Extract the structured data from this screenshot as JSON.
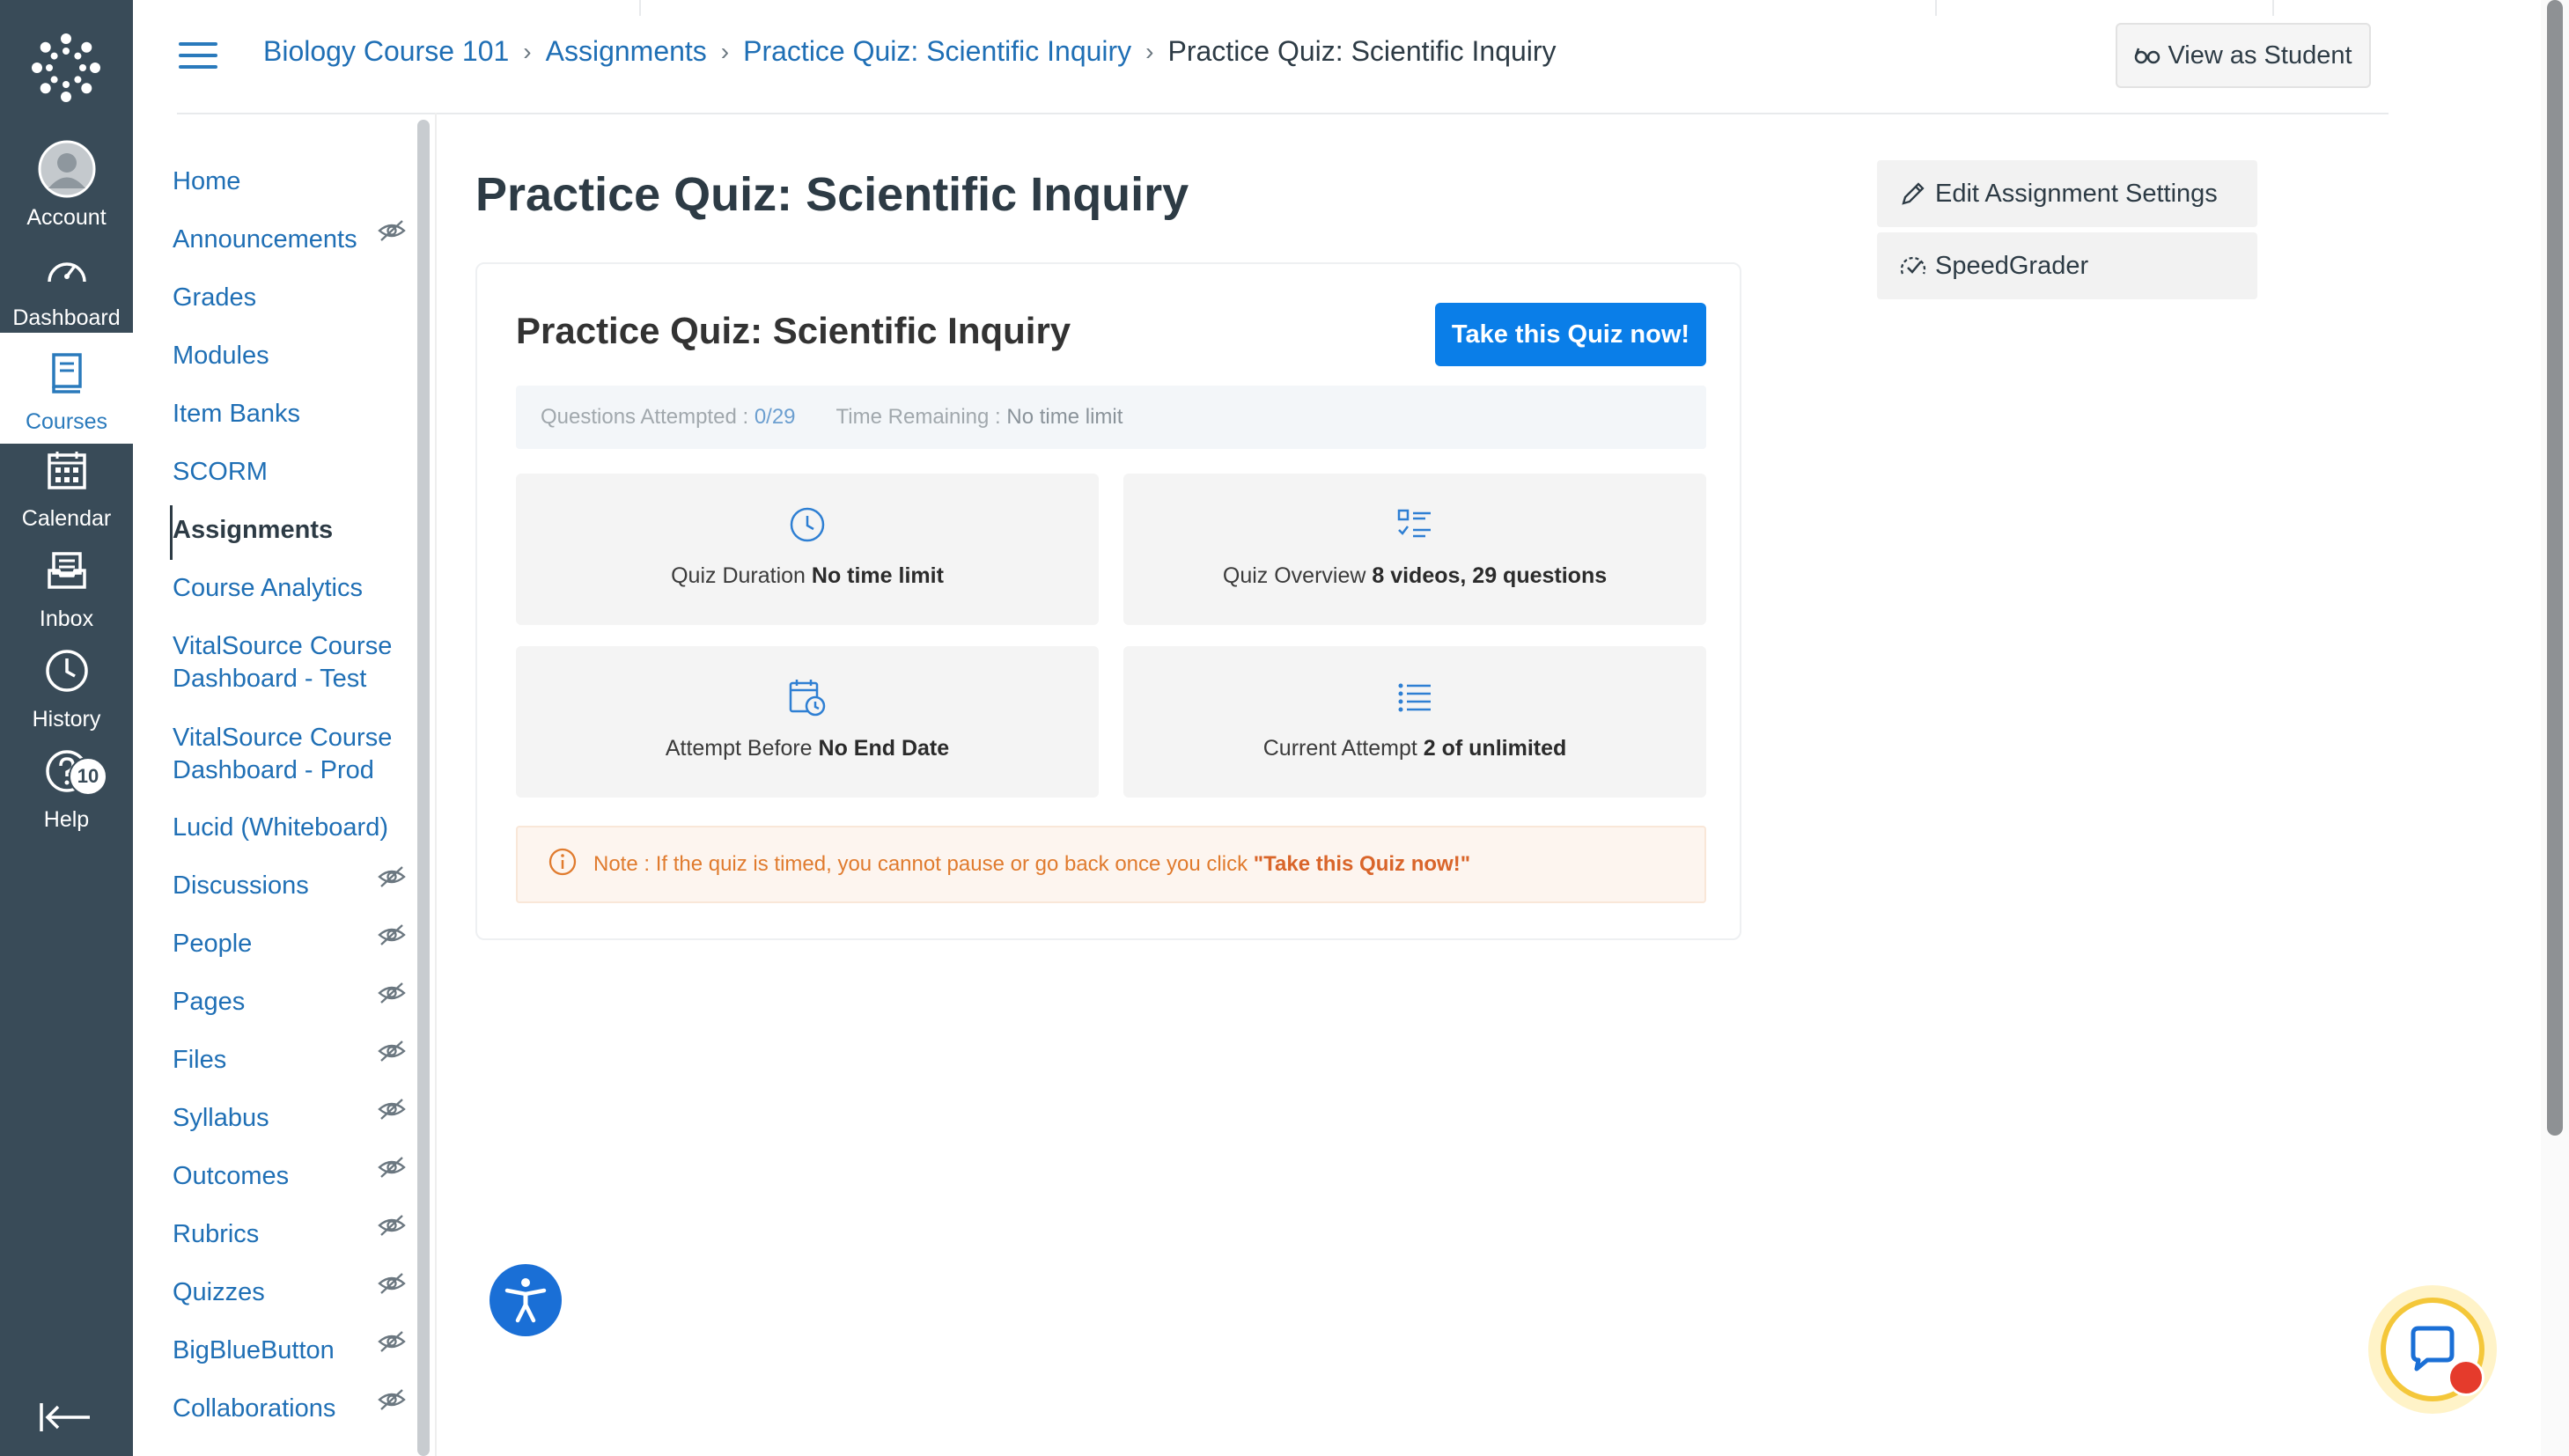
{
  "global_nav": {
    "items": [
      {
        "label": "Account",
        "icon": "account-avatar-icon"
      },
      {
        "label": "Dashboard",
        "icon": "dashboard-gauge-icon"
      },
      {
        "label": "Courses",
        "icon": "courses-book-icon",
        "active": true
      },
      {
        "label": "Calendar",
        "icon": "calendar-icon"
      },
      {
        "label": "Inbox",
        "icon": "inbox-icon"
      },
      {
        "label": "History",
        "icon": "clock-icon"
      },
      {
        "label": "Help",
        "icon": "help-question-icon",
        "badge": "10"
      }
    ]
  },
  "header": {
    "breadcrumbs": [
      {
        "label": "Biology Course 101"
      },
      {
        "label": "Assignments"
      },
      {
        "label": "Practice Quiz: Scientific Inquiry"
      },
      {
        "label": "Practice Quiz: Scientific Inquiry"
      }
    ],
    "view_as_student": "View as Student"
  },
  "course_nav": {
    "items": [
      {
        "label": "Home"
      },
      {
        "label": "Announcements",
        "hidden": true
      },
      {
        "label": "Grades"
      },
      {
        "label": "Modules"
      },
      {
        "label": "Item Banks"
      },
      {
        "label": "SCORM"
      },
      {
        "label": "Assignments",
        "active": true
      },
      {
        "label": "Course Analytics"
      },
      {
        "label": "VitalSource Course Dashboard - Test"
      },
      {
        "label": "VitalSource Course Dashboard - Prod"
      },
      {
        "label": "Lucid (Whiteboard)"
      },
      {
        "label": "Discussions",
        "hidden": true
      },
      {
        "label": "People",
        "hidden": true
      },
      {
        "label": "Pages",
        "hidden": true
      },
      {
        "label": "Files",
        "hidden": true
      },
      {
        "label": "Syllabus",
        "hidden": true
      },
      {
        "label": "Outcomes",
        "hidden": true
      },
      {
        "label": "Rubrics",
        "hidden": true
      },
      {
        "label": "Quizzes",
        "hidden": true
      },
      {
        "label": "BigBlueButton",
        "hidden": true
      },
      {
        "label": "Collaborations",
        "hidden": true
      }
    ]
  },
  "main": {
    "page_title": "Practice Quiz: Scientific Inquiry",
    "quiz": {
      "title": "Practice Quiz: Scientific Inquiry",
      "take_button": "Take this Quiz now!",
      "attempted_label": "Questions Attempted : ",
      "attempted_value": "0/29",
      "remaining_label": "Time Remaining : ",
      "remaining_value": "No time limit",
      "tiles": [
        {
          "label": "Quiz Duration ",
          "value": "No time limit",
          "icon": "clock-icon"
        },
        {
          "label": "Quiz Overview ",
          "value": "8 videos, 29 questions",
          "icon": "checklist-icon"
        },
        {
          "label": "Attempt Before ",
          "value": "No End Date",
          "icon": "calendar-clock-icon"
        },
        {
          "label": "Current Attempt ",
          "value": "2 of unlimited",
          "icon": "list-icon"
        }
      ],
      "note_prefix": "Note : If the quiz is timed, you cannot pause or go back once you click ",
      "note_emphasis": "\"Take this Quiz now!\""
    }
  },
  "sidebar_actions": {
    "edit_settings": "Edit Assignment Settings",
    "speedgrader": "SpeedGrader"
  },
  "colors": {
    "global_nav_bg": "#394b58",
    "link": "#1f6fb5",
    "primary_button": "#0a7ee8",
    "note_text": "#e07b2e"
  }
}
